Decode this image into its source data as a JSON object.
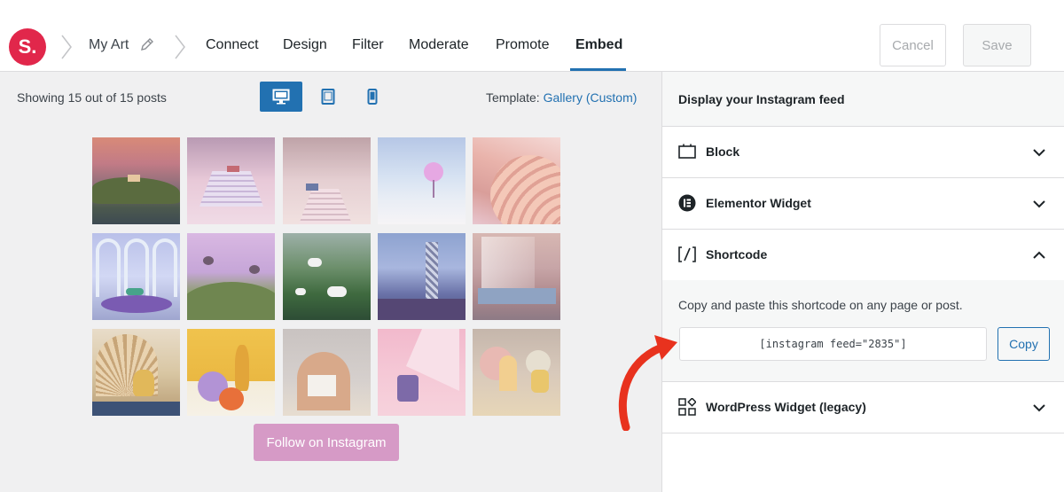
{
  "header": {
    "logo_text": "S.",
    "breadcrumb": "My Art",
    "nav": [
      "Connect",
      "Design",
      "Filter",
      "Moderate",
      "Promote",
      "Embed"
    ],
    "active_nav": "Embed",
    "cancel_label": "Cancel",
    "save_label": "Save"
  },
  "preview": {
    "showing_text": "Showing 15 out of 15 posts",
    "template_label": "Template:",
    "template_value": "Gallery (Custom)",
    "follow_label": "Follow on Instagram"
  },
  "panel": {
    "title": "Display your Instagram feed",
    "sections": [
      {
        "label": "Block",
        "icon": "block-icon",
        "expanded": false
      },
      {
        "label": "Elementor Widget",
        "icon": "elementor-icon",
        "expanded": false
      },
      {
        "label": "Shortcode",
        "icon": "shortcode-icon",
        "expanded": true
      },
      {
        "label": "WordPress Widget (legacy)",
        "icon": "widget-grid-icon",
        "expanded": false
      }
    ],
    "shortcode_help": "Copy and paste this shortcode on any page or post.",
    "shortcode_value": "[instagram feed=\"2835\"]",
    "copy_label": "Copy"
  },
  "colors": {
    "brand": "#e1274b",
    "accent": "#2271b1",
    "follow_button": "#d69ac6",
    "arrow": "#e8321e"
  }
}
